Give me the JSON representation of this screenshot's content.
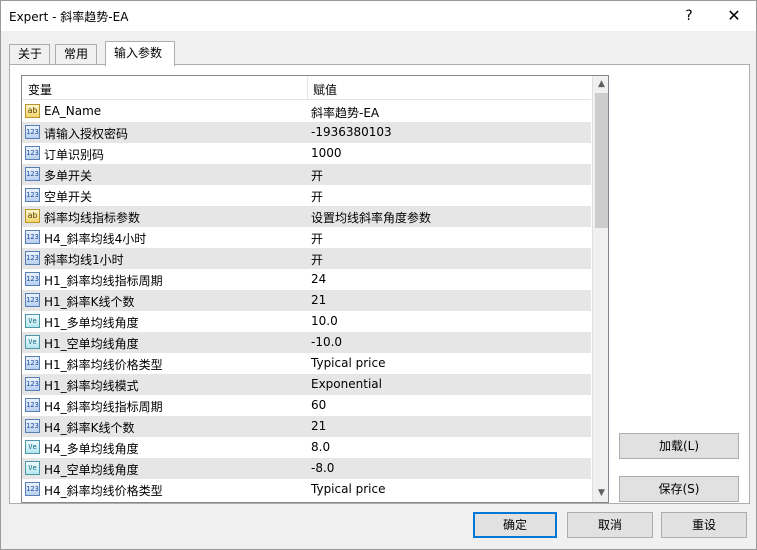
{
  "window": {
    "title": "Expert - 斜率趋势-EA",
    "help_glyph": "?",
    "close_glyph": "✕"
  },
  "tabs": [
    {
      "label": "关于",
      "active": false
    },
    {
      "label": "常用",
      "active": false
    },
    {
      "label": "输入参数",
      "active": true
    }
  ],
  "grid": {
    "header": {
      "variable": "变量",
      "value": "赋值"
    },
    "rows": [
      {
        "icon": "ab",
        "name": "EA_Name",
        "value": "斜率趋势-EA"
      },
      {
        "icon": "123",
        "name": "请输入授权密码",
        "value": "-1936380103"
      },
      {
        "icon": "123",
        "name": "订单识别码",
        "value": "1000"
      },
      {
        "icon": "123",
        "name": "多单开关",
        "value": "开"
      },
      {
        "icon": "123",
        "name": "空单开关",
        "value": "开"
      },
      {
        "icon": "ab",
        "name": "斜率均线指标参数",
        "value": "设置均线斜率角度参数"
      },
      {
        "icon": "123",
        "name": "H4_斜率均线4小时",
        "value": "开"
      },
      {
        "icon": "123",
        "name": "斜率均线1小时",
        "value": "开"
      },
      {
        "icon": "123",
        "name": "H1_斜率均线指标周期",
        "value": "24"
      },
      {
        "icon": "123",
        "name": "H1_斜率K线个数",
        "value": "21"
      },
      {
        "icon": "ve",
        "name": "H1_多单均线角度",
        "value": "10.0"
      },
      {
        "icon": "ve",
        "name": "H1_空单均线角度",
        "value": "-10.0"
      },
      {
        "icon": "123",
        "name": "H1_斜率均线价格类型",
        "value": "Typical price"
      },
      {
        "icon": "123",
        "name": "H1_斜率均线模式",
        "value": "Exponential"
      },
      {
        "icon": "123",
        "name": "H4_斜率均线指标周期",
        "value": "60"
      },
      {
        "icon": "123",
        "name": "H4_斜率K线个数",
        "value": "21"
      },
      {
        "icon": "ve",
        "name": "H4_多单均线角度",
        "value": "8.0"
      },
      {
        "icon": "ve",
        "name": "H4_空单均线角度",
        "value": "-8.0"
      },
      {
        "icon": "123",
        "name": "H4_斜率均线价格类型",
        "value": "Typical price"
      }
    ],
    "scroll_up_glyph": "▲",
    "scroll_down_glyph": "▼"
  },
  "buttons": {
    "load": "加载(L)",
    "save": "保存(S)",
    "ok": "确定",
    "cancel": "取消",
    "reset": "重设"
  },
  "colors": {
    "accent": "#0078d7",
    "alt_row": "#e6e6e6"
  }
}
